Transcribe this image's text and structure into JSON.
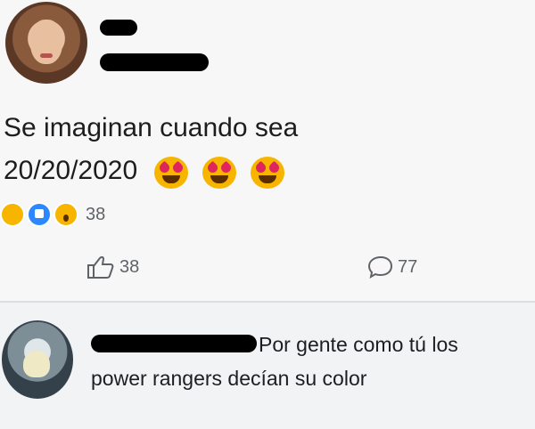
{
  "post": {
    "text_line1": "Se imaginan cuando sea",
    "text_line2": "20/20/2020",
    "emoji": [
      "heart-eyes-emoji",
      "heart-eyes-emoji",
      "heart-eyes-emoji"
    ],
    "reaction_icons": [
      "haha-icon",
      "like-icon",
      "wow-icon"
    ],
    "reaction_count": "38"
  },
  "actions": {
    "like_count": "38",
    "comment_count": "77"
  },
  "comment": {
    "text_line1": "Por gente como tú los",
    "text_line2": "power rangers decían su color"
  },
  "colors": {
    "like_blue": "#2d88ff",
    "emoji_yellow": "#f7b500",
    "text": "#1c1e21",
    "muted": "#5f6368"
  }
}
